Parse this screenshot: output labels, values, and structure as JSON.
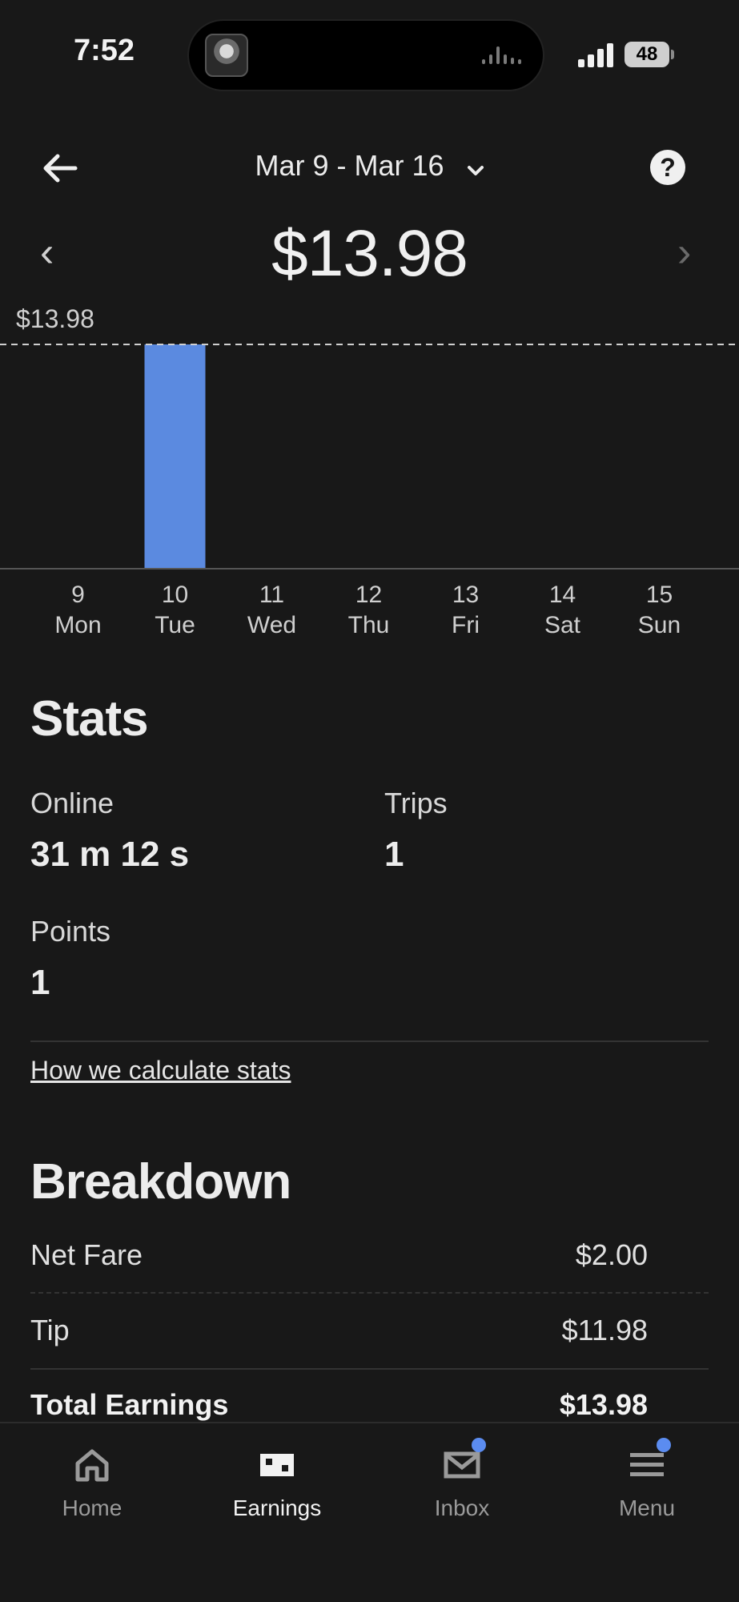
{
  "status_bar": {
    "time": "7:52",
    "battery": "48"
  },
  "header": {
    "date_range": "Mar 9 - Mar 16",
    "total": "$13.98"
  },
  "chart_data": {
    "type": "bar",
    "categories": [
      "9 Mon",
      "10 Tue",
      "11 Wed",
      "12 Thu",
      "13 Fri",
      "14 Sat",
      "15 Sun"
    ],
    "days": [
      "9",
      "10",
      "11",
      "12",
      "13",
      "14",
      "15"
    ],
    "weekdays": [
      "Mon",
      "Tue",
      "Wed",
      "Thu",
      "Fri",
      "Sat",
      "Sun"
    ],
    "values": [
      0,
      13.98,
      0,
      0,
      0,
      0,
      0
    ],
    "max_label": "$13.98",
    "ylim": [
      0,
      13.98
    ],
    "bar_color": "#5b8ae0"
  },
  "stats": {
    "title": "Stats",
    "online_label": "Online",
    "online_value": "31 m 12 s",
    "trips_label": "Trips",
    "trips_value": "1",
    "points_label": "Points",
    "points_value": "1",
    "calc_link": "How we calculate stats"
  },
  "breakdown": {
    "title": "Breakdown",
    "rows": [
      {
        "label": "Net Fare",
        "value": "$2.00"
      },
      {
        "label": "Tip",
        "value": "$11.98"
      },
      {
        "label": "Total Earnings",
        "value": "$13.98"
      }
    ]
  },
  "nav": {
    "items": [
      {
        "label": "Home"
      },
      {
        "label": "Earnings"
      },
      {
        "label": "Inbox"
      },
      {
        "label": "Menu"
      }
    ],
    "accent": "#5b8cf0"
  }
}
